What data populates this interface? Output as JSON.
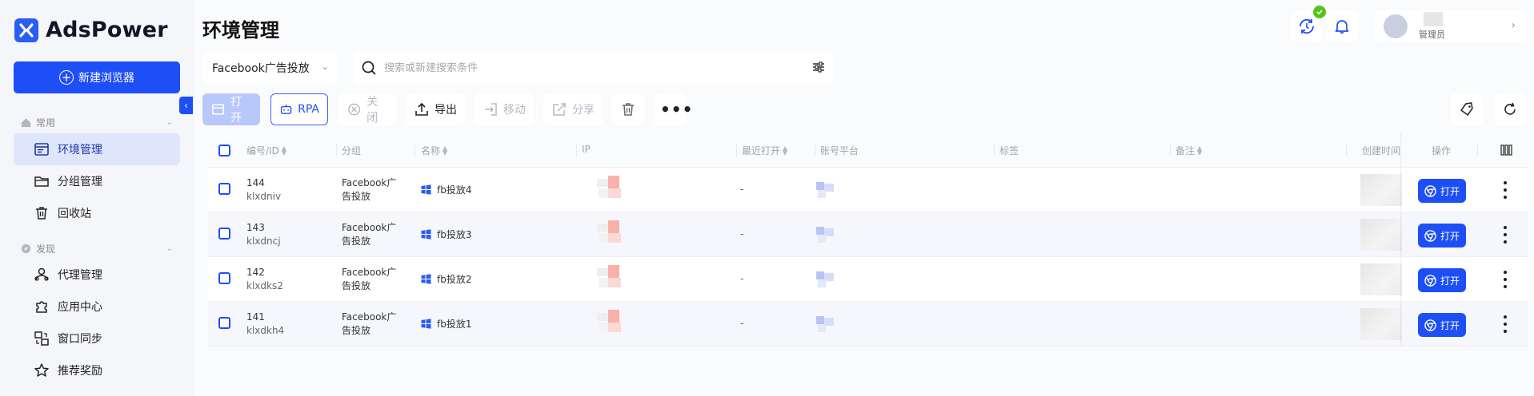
{
  "app": {
    "name": "AdsPower"
  },
  "sidebar": {
    "new_browser": "新建浏览器",
    "sections": [
      {
        "label": "常用",
        "icon": "home-icon"
      },
      {
        "label": "发现",
        "icon": "compass-icon"
      }
    ],
    "items": [
      {
        "label": "环境管理",
        "icon": "browser-window-icon",
        "active": true
      },
      {
        "label": "分组管理",
        "icon": "folder-icon"
      },
      {
        "label": "回收站",
        "icon": "trash-icon"
      },
      {
        "label": "代理管理",
        "icon": "proxy-icon"
      },
      {
        "label": "应用中心",
        "icon": "puzzle-icon"
      },
      {
        "label": "窗口同步",
        "icon": "sync-window-icon"
      },
      {
        "label": "推荐奖励",
        "icon": "star-icon"
      }
    ]
  },
  "header": {
    "title": "环境管理",
    "user_role": "管理员"
  },
  "filters": {
    "group": "Facebook广告投放",
    "search_placeholder": "搜索或新建搜索条件"
  },
  "toolbar": {
    "open": "打开",
    "rpa": "RPA",
    "close": "关闭",
    "export": "导出",
    "move": "移动",
    "share": "分享"
  },
  "table": {
    "columns": {
      "id": "编号/ID",
      "group": "分组",
      "name": "名称",
      "ip": "IP",
      "last_open": "最近打开",
      "platform": "账号平台",
      "tags": "标签",
      "notes": "备注",
      "created": "创建时间",
      "actions": "操作"
    },
    "row_open_label": "打开",
    "rows": [
      {
        "num": "144",
        "uid": "klxdniv",
        "group": "Facebook广告投放",
        "name": "fb投放4",
        "last_open": "-"
      },
      {
        "num": "143",
        "uid": "klxdncj",
        "group": "Facebook广告投放",
        "name": "fb投放3",
        "last_open": "-"
      },
      {
        "num": "142",
        "uid": "klxdks2",
        "group": "Facebook广告投放",
        "name": "fb投放2",
        "last_open": "-"
      },
      {
        "num": "141",
        "uid": "klxdkh4",
        "group": "Facebook广告投放",
        "name": "fb投放1",
        "last_open": "-"
      }
    ]
  },
  "colors": {
    "accent": "#1e4ff6",
    "active_nav_bg": "#dfe5fb",
    "status_ok": "#52c41a"
  }
}
